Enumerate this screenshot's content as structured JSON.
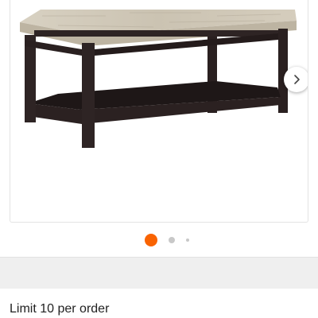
{
  "product_image": {
    "subject": "coffee table",
    "top_color": "#cfc7b6",
    "frame_color": "#2a2020"
  },
  "carousel": {
    "next_icon": "chevron-right-icon",
    "slide_count": 3,
    "active_index": 0,
    "active_dot_color": "#f96302",
    "inactive_dot_color": "#c8c8c8"
  },
  "order": {
    "limit_text": "Limit 10 per order"
  }
}
